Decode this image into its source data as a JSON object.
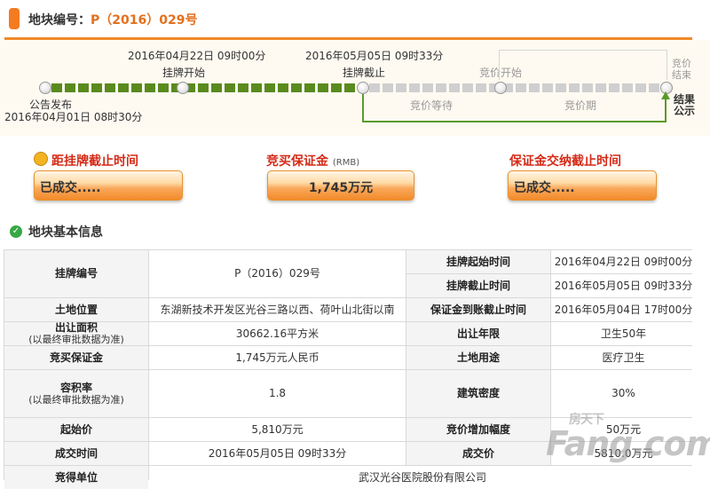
{
  "header": {
    "title": "地块编号：",
    "code": "P（2016）029号"
  },
  "timeline": {
    "announce_label": "公告发布",
    "announce_date": "2016年04月01日  08时30分",
    "listing_start_label": "挂牌开始",
    "listing_start_date": "2016年04月22日  09时00分",
    "listing_end_label": "挂牌截止",
    "listing_end_date": "2016年05月05日  09时33分",
    "bidding_start_label": "竞价开始",
    "bidding_end_label": "竞价结束",
    "result_label": "结果公示",
    "waiting_label": "竞价等待",
    "bidding_period_label": "竞价期"
  },
  "cards": [
    {
      "title": "距挂牌截止时间",
      "value": "已成交....."
    },
    {
      "title": "竞买保证金",
      "unit": "(RMB)",
      "value": "1,745万元"
    },
    {
      "title": "保证金交纳截止时间",
      "value": "已成交....."
    }
  ],
  "section": {
    "title": "地块基本信息"
  },
  "table": {
    "code_label": "挂牌编号",
    "code_value": "P（2016）029号",
    "list_start_label": "挂牌起始时间",
    "list_start_value": "2016年04月22日  09时00分",
    "list_end_label": "挂牌截止时间",
    "list_end_value": "2016年05月05日  09时33分",
    "location_label": "土地位置",
    "location_value": "东湖新技术开发区光谷三路以西、荷叶山北街以南",
    "deposit_deadline_label": "保证金到账截止时间",
    "deposit_deadline_value": "2016年05月04日  17时00分",
    "area_label": "出让面积",
    "area_note": "(以最终审批数据为准)",
    "area_value": "30662.16平方米",
    "term_label": "出让年限",
    "term_value": "卫生50年",
    "deposit_label": "竞买保证金",
    "deposit_value": "1,745万元人民币",
    "use_label": "土地用途",
    "use_value": "医疗卫生",
    "far_label": "容积率",
    "far_note": "(以最终审批数据为准)",
    "far_value": "1.8",
    "density_label": "建筑密度",
    "density_value": "30%",
    "start_price_label": "起始价",
    "start_price_value": "5,810万元",
    "increment_label": "竞价增加幅度",
    "increment_value": "50万元",
    "deal_time_label": "成交时间",
    "deal_time_value": "2016年05月05日  09时33分",
    "deal_price_label": "成交价",
    "deal_price_value": "5810.0万元",
    "winner_label": "竞得单位",
    "winner_value": "武汉光谷医院股份有限公司"
  },
  "watermark": {
    "brand": "房天下",
    "text": "Fang.com"
  },
  "colors": {
    "accent": "#f08a2a",
    "progress_done": "#5a8a1e",
    "card_title": "#d42b17"
  }
}
